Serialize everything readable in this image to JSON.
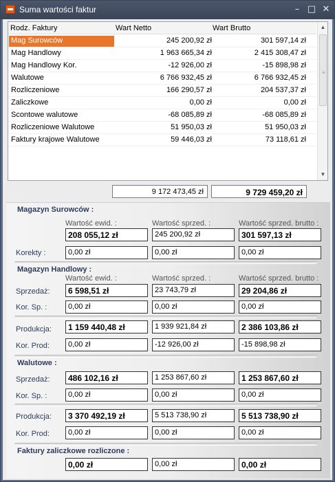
{
  "window": {
    "title": "Suma wartości faktur",
    "minimize": "–",
    "maximize": "□",
    "close": "✕"
  },
  "list": {
    "columns": [
      "Rodz. Faktury",
      "Wart Netto",
      "Wart Brutto"
    ],
    "rows": [
      {
        "name": "Mag Surowców",
        "netto": "245 200,92 zł",
        "brutto": "301 597,14 zł",
        "selected": true
      },
      {
        "name": "Mag Handlowy",
        "netto": "1 963 665,34 zł",
        "brutto": "2 415 308,47 zł"
      },
      {
        "name": "Mag Handlowy Kor.",
        "netto": "-12 926,00 zł",
        "brutto": "-15 898,98 zł"
      },
      {
        "name": "Walutowe",
        "netto": "6 766 932,45 zł",
        "brutto": "6 766 932,45 zł"
      },
      {
        "name": "Rozliczeniowe",
        "netto": "166 290,57 zł",
        "brutto": "204 537,37 zł"
      },
      {
        "name": "Zaliczkowe",
        "netto": "0,00 zł",
        "brutto": "0,00 zł"
      },
      {
        "name": "Scontowe walutowe",
        "netto": "-68 085,89 zł",
        "brutto": "-68 085,89 zł"
      },
      {
        "name": "Rozliczeniowe Walutowe",
        "netto": "51 950,03 zł",
        "brutto": "51 950,03 zł"
      },
      {
        "name": "Faktury krajowe Walutowe",
        "netto": "59 446,03 zł",
        "brutto": "73 118,61 zł"
      }
    ]
  },
  "totals": {
    "netto": "9 172 473,45 zł",
    "brutto": "9 729 459,20 zł"
  },
  "magazyn_surowcow": {
    "title": "Magazyn Surowców :",
    "col1": "Wartość ewid. :",
    "col2": "Wartość sprzed. :",
    "col3": "Wartość sprzed. brutto :",
    "main": [
      "208 055,12 zł",
      "245 200,92 zł",
      "301 597,13 zł"
    ],
    "korekty_label": "Korekty :",
    "korekty": [
      "0,00 zł",
      "0,00 zł",
      "0,00 zł"
    ]
  },
  "magazyn_handlowy": {
    "title": "Magazyn Handlowy :",
    "col1": "Wartość ewid. :",
    "col2": "Wartość sprzed. :",
    "col3": "Wartość sprzed. brutto :",
    "sprzedaz_label": "Sprzedaż:",
    "sprzedaz": [
      "6 598,51 zł",
      "23 743,79 zł",
      "29 204,86 zł"
    ],
    "kor_sp_label": "Kor. Sp. :",
    "kor_sp": [
      "0,00 zł",
      "0,00 zł",
      "0,00 zł"
    ],
    "produkcja_label": "Produkcja:",
    "produkcja": [
      "1 159 440,48 zł",
      "1 939 921,84 zł",
      "2 386 103,86 zł"
    ],
    "kor_prod_label": "Kor. Prod:",
    "kor_prod": [
      "0,00 zł",
      "-12 926,00 zł",
      "-15 898,98 zł"
    ]
  },
  "walutowe": {
    "title": "Walutowe :",
    "sprzedaz_label": "Sprzedaż:",
    "sprzedaz": [
      "486 102,16 zł",
      "1 253 867,60 zł",
      "1 253 867,60 zł"
    ],
    "kor_sp_label": "Kor. Sp. :",
    "kor_sp": [
      "0,00 zł",
      "0,00 zł",
      "0,00 zł"
    ],
    "produkcja_label": "Produkcja:",
    "produkcja": [
      "3 370 492,19 zł",
      "5 513 738,90 zł",
      "5 513 738,90 zł"
    ],
    "kor_prod_label": "Kor. Prod:",
    "kor_prod": [
      "0,00 zł",
      "0,00 zł",
      "0,00 zł"
    ]
  },
  "zaliczkowe": {
    "title": "Faktury zaliczkowe rozliczone :",
    "values": [
      "0,00 zł",
      "0,00 zł",
      "0,00 zł"
    ]
  }
}
